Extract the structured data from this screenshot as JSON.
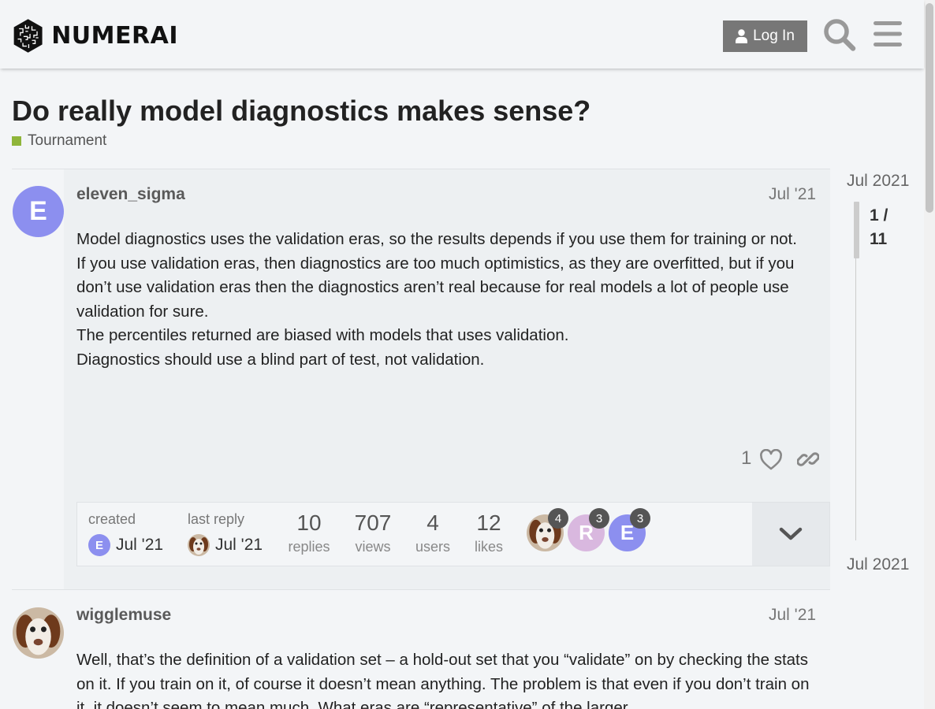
{
  "header": {
    "brand": "NUMERAI",
    "login_label": "Log In",
    "search_icon": "search-icon",
    "menu_icon": "hamburger-menu-icon"
  },
  "topic": {
    "title": "Do really model diagnostics makes sense?",
    "category": "Tournament",
    "category_color": "#8fb53a"
  },
  "posts": [
    {
      "username": "eleven_sigma",
      "avatar_letter": "E",
      "avatar_color": "#8c8fef",
      "date": "Jul '21",
      "paragraphs": [
        "Model diagnostics uses the validation eras, so the results depends if you use them for training or not.",
        "If you use validation eras, then diagnostics are too much optimistics, as they are overfitted, but if you don’t use validation eras then the diagnostics aren’t real because for real models a lot of people use validation for sure.",
        "The percentiles returned are biased with models that uses validation.",
        "Diagnostics should use a blind part of test, not validation."
      ],
      "likes": "1"
    },
    {
      "username": "wigglemuse",
      "date": "Jul '21",
      "paragraphs": [
        "Well, that’s the definition of a validation set – a hold-out set that you “validate” on by checking the stats on it. If you train on it, of course it doesn’t mean anything. The problem is that even if you don’t train on it, it doesn’t seem to mean much. What eras are “representative” of the larger"
      ]
    }
  ],
  "topic_map": {
    "created_label": "created",
    "created_date": "Jul '21",
    "last_reply_label": "last reply",
    "last_reply_date": "Jul '21",
    "replies": "10",
    "replies_label": "replies",
    "views": "707",
    "views_label": "views",
    "users": "4",
    "users_label": "users",
    "likes": "12",
    "likes_label": "likes",
    "participants": [
      {
        "letter": "",
        "count": "4"
      },
      {
        "letter": "R",
        "count": "3",
        "color": "#d9b8df"
      },
      {
        "letter": "E",
        "count": "3",
        "color": "#8c8fef"
      }
    ]
  },
  "timeline": {
    "start": "Jul 2021",
    "position": "1 /",
    "total": "11",
    "end": "Jul 2021"
  }
}
